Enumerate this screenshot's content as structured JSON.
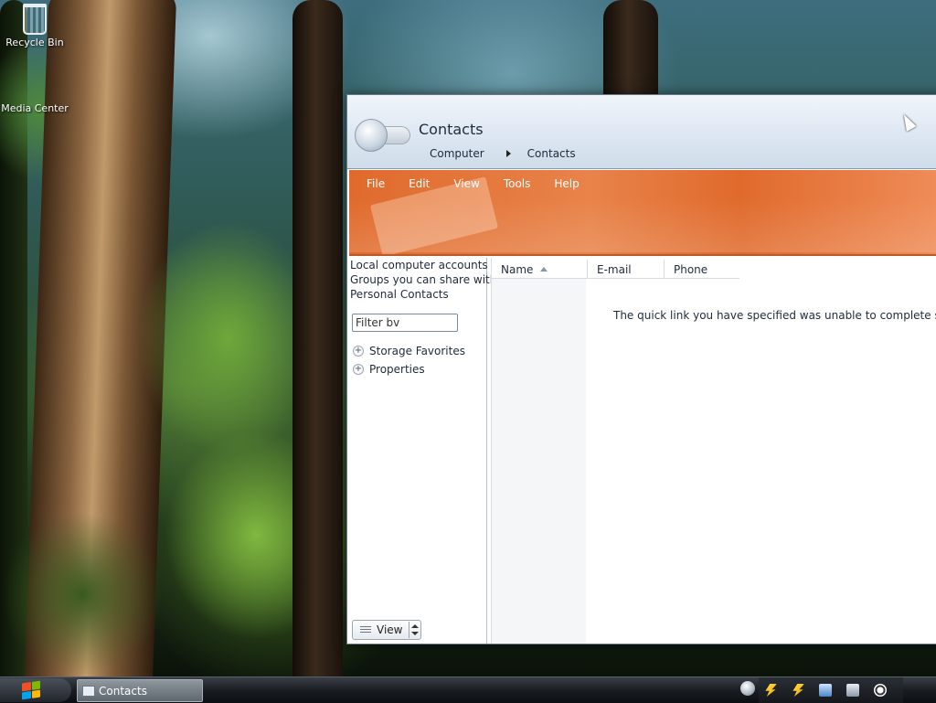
{
  "desktop": {
    "icons": [
      {
        "label": "Recycle Bin",
        "icon": "recycle-bin-icon"
      },
      {
        "label": "Media Center",
        "icon": "media-center-icon"
      }
    ]
  },
  "window": {
    "title": "Contacts",
    "breadcrumb": [
      "Computer",
      "Contacts"
    ],
    "menu": [
      "File",
      "Edit",
      "View",
      "Tools",
      "Help"
    ],
    "accent_color": "#e06a2c",
    "left_pane": {
      "lines": [
        "Local computer accounts",
        "Groups you can share with",
        "Personal Contacts"
      ],
      "filter_value": "Filter bv",
      "tree": [
        "Storage Favorites",
        "Properties"
      ],
      "view_button": "View"
    },
    "columns": [
      "Name",
      "E-mail",
      "Phone"
    ],
    "message": "The quick link you have specified was unable to complete successfu"
  },
  "taskbar": {
    "task_button": "Contacts",
    "tray_icons": [
      "power-icon",
      "power-icon",
      "network-icon",
      "monitor-icon",
      "clock-icon"
    ]
  }
}
